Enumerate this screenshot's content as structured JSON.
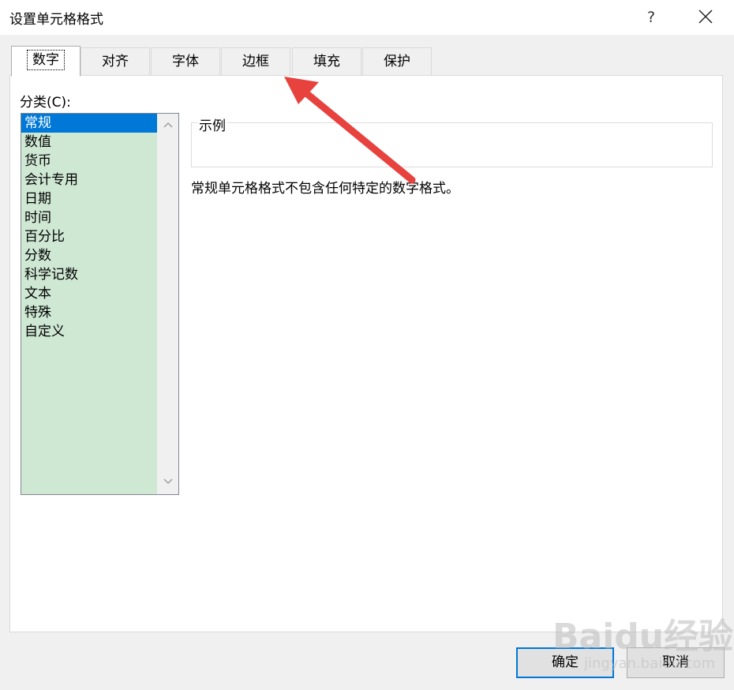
{
  "window": {
    "title": "设置单元格格式",
    "help_label": "?",
    "close_icon": "close-icon"
  },
  "tabs": [
    {
      "label": "数字",
      "active": true
    },
    {
      "label": "对齐",
      "active": false
    },
    {
      "label": "字体",
      "active": false
    },
    {
      "label": "边框",
      "active": false
    },
    {
      "label": "填充",
      "active": false
    },
    {
      "label": "保护",
      "active": false
    }
  ],
  "category": {
    "label": "分类(C):",
    "items": [
      "常规",
      "数值",
      "货币",
      "会计专用",
      "日期",
      "时间",
      "百分比",
      "分数",
      "科学记数",
      "文本",
      "特殊",
      "自定义"
    ],
    "selected": "常规"
  },
  "sample": {
    "legend": "示例"
  },
  "description": "常规单元格格式不包含任何特定的数字格式。",
  "buttons": {
    "ok": "确定",
    "cancel": "取消"
  },
  "annotation": {
    "arrow_color": "#e8423f",
    "arrow_target": "边框"
  },
  "watermark": {
    "main": "Baidu经验",
    "sub": "jingyan.baidu.com"
  },
  "colors": {
    "selection": "#0078d7",
    "list_background": "#cfe8d4",
    "dialog_background": "#f0f0f0"
  }
}
